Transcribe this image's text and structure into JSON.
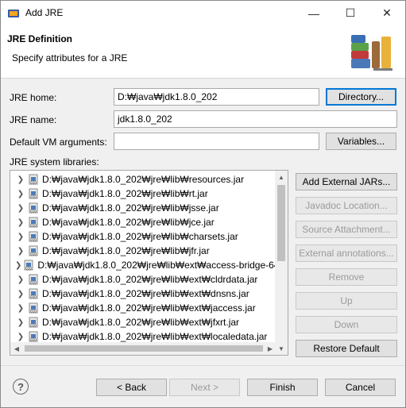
{
  "window": {
    "title": "Add JRE",
    "minimize_glyph": "—",
    "maximize_glyph": "☐",
    "close_glyph": "✕"
  },
  "header": {
    "title": "JRE Definition",
    "description": "Specify attributes for a JRE",
    "banner_icon": "books-icon"
  },
  "form": {
    "jre_home_label": "JRE home:",
    "jre_home_value": "D:₩java₩jdk1.8.0_202",
    "directory_button": "Directory...",
    "jre_name_label": "JRE name:",
    "jre_name_value": "jdk1.8.0_202",
    "vm_args_label": "Default VM arguments:",
    "vm_args_value": "",
    "variables_button": "Variables..."
  },
  "libraries": {
    "label": "JRE system libraries:",
    "items": [
      "D:₩java₩jdk1.8.0_202₩jre₩lib₩resources.jar",
      "D:₩java₩jdk1.8.0_202₩jre₩lib₩rt.jar",
      "D:₩java₩jdk1.8.0_202₩jre₩lib₩jsse.jar",
      "D:₩java₩jdk1.8.0_202₩jre₩lib₩jce.jar",
      "D:₩java₩jdk1.8.0_202₩jre₩lib₩charsets.jar",
      "D:₩java₩jdk1.8.0_202₩jre₩lib₩jfr.jar",
      "D:₩java₩jdk1.8.0_202₩jre₩lib₩ext₩access-bridge-64.",
      "D:₩java₩jdk1.8.0_202₩jre₩lib₩ext₩cldrdata.jar",
      "D:₩java₩jdk1.8.0_202₩jre₩lib₩ext₩dnsns.jar",
      "D:₩java₩jdk1.8.0_202₩jre₩lib₩ext₩jaccess.jar",
      "D:₩java₩jdk1.8.0_202₩jre₩lib₩ext₩jfxrt.jar",
      "D:₩java₩jdk1.8.0_202₩jre₩lib₩ext₩localedata.jar"
    ],
    "buttons": {
      "add_external_jars": "Add External JARs...",
      "javadoc_location": "Javadoc Location...",
      "source_attachment": "Source Attachment...",
      "external_annotations": "External annotations...",
      "remove": "Remove",
      "up": "Up",
      "down": "Down",
      "restore_default": "Restore Default"
    }
  },
  "footer": {
    "help_glyph": "?",
    "back": "< Back",
    "next": "Next >",
    "finish": "Finish",
    "cancel": "Cancel"
  },
  "colors": {
    "accent": "#0078d7",
    "disabled_text": "#9a9a9a"
  }
}
